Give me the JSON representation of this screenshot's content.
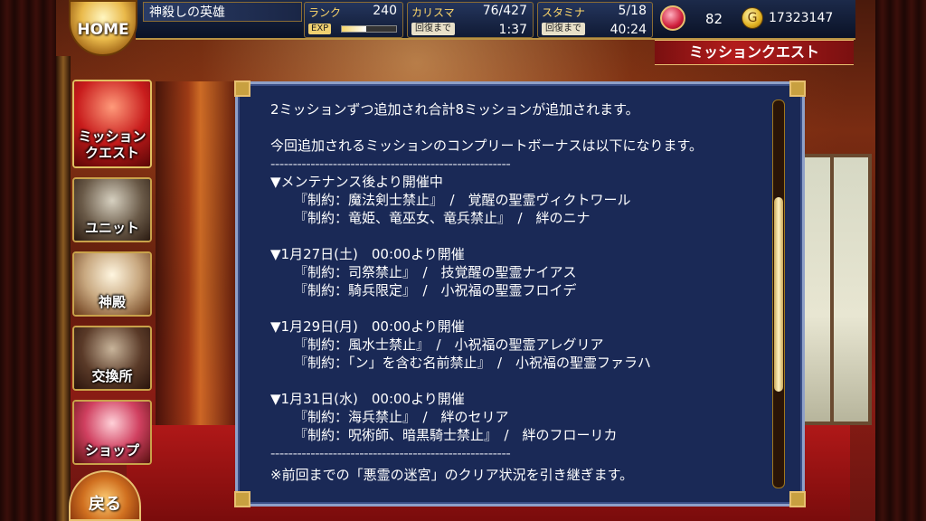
{
  "header": {
    "home_label": "HOME",
    "player_name": "神殺しの英雄",
    "rank": {
      "label": "ランク",
      "value": "240",
      "exp_label": "EXP",
      "exp_progress": 0.45
    },
    "charisma": {
      "label": "カリスマ",
      "value": "76/427",
      "recover_label": "回復まで",
      "recover_time": "1:37"
    },
    "stamina": {
      "label": "スタミナ",
      "value": "5/18",
      "recover_label": "回復まで",
      "recover_time": "40:24"
    },
    "gems": "82",
    "gold_symbol": "G",
    "gold": "17323147"
  },
  "screen_title": "ミッションクエスト",
  "sidebar": {
    "items": [
      {
        "label": "ミッション\nクエスト",
        "icon": "mission-quest-icon"
      },
      {
        "label": "ユニット",
        "icon": "unit-icon"
      },
      {
        "label": "神殿",
        "icon": "temple-icon"
      },
      {
        "label": "交換所",
        "icon": "exchange-icon"
      },
      {
        "label": "ショップ",
        "icon": "shop-icon"
      }
    ],
    "back_label": "戻る"
  },
  "dialog": {
    "intro": "2ミッションずつ追加され合計8ミッションが追加されます。",
    "bonus_intro": "今回追加されるミッションのコンプリートボーナスは以下になります。",
    "separator": "------------------------------------------------------",
    "groups": [
      {
        "heading": "▼メンテナンス後より開催中",
        "items": [
          "『制約：魔法剣士禁止』　/　覚醒の聖霊ヴィクトワール",
          "『制約：竜姫、竜巫女、竜兵禁止』　/　絆のニナ"
        ]
      },
      {
        "heading": "▼1月27日(土)　00:00より開催",
        "items": [
          "『制約：司祭禁止』　/　技覚醒の聖霊ナイアス",
          "『制約：騎兵限定』　/　小祝福の聖霊フロイデ"
        ]
      },
      {
        "heading": "▼1月29日(月)　00:00より開催",
        "items": [
          "『制約：風水士禁止』　/　小祝福の聖霊アレグリア",
          "『制約：「ン」を含む名前禁止』　/　小祝福の聖霊ファラハ"
        ]
      },
      {
        "heading": "▼1月31日(水)　00:00より開催",
        "items": [
          "『制約：海兵禁止』　/　絆のセリア",
          "『制約：呪術師、暗黒騎士禁止』　/　絆のフローリカ"
        ]
      }
    ],
    "cut_line": "※前回までの「悪霊の迷宮」のクリア状況を引き継ぎます。",
    "scroll_position": 0.5
  }
}
